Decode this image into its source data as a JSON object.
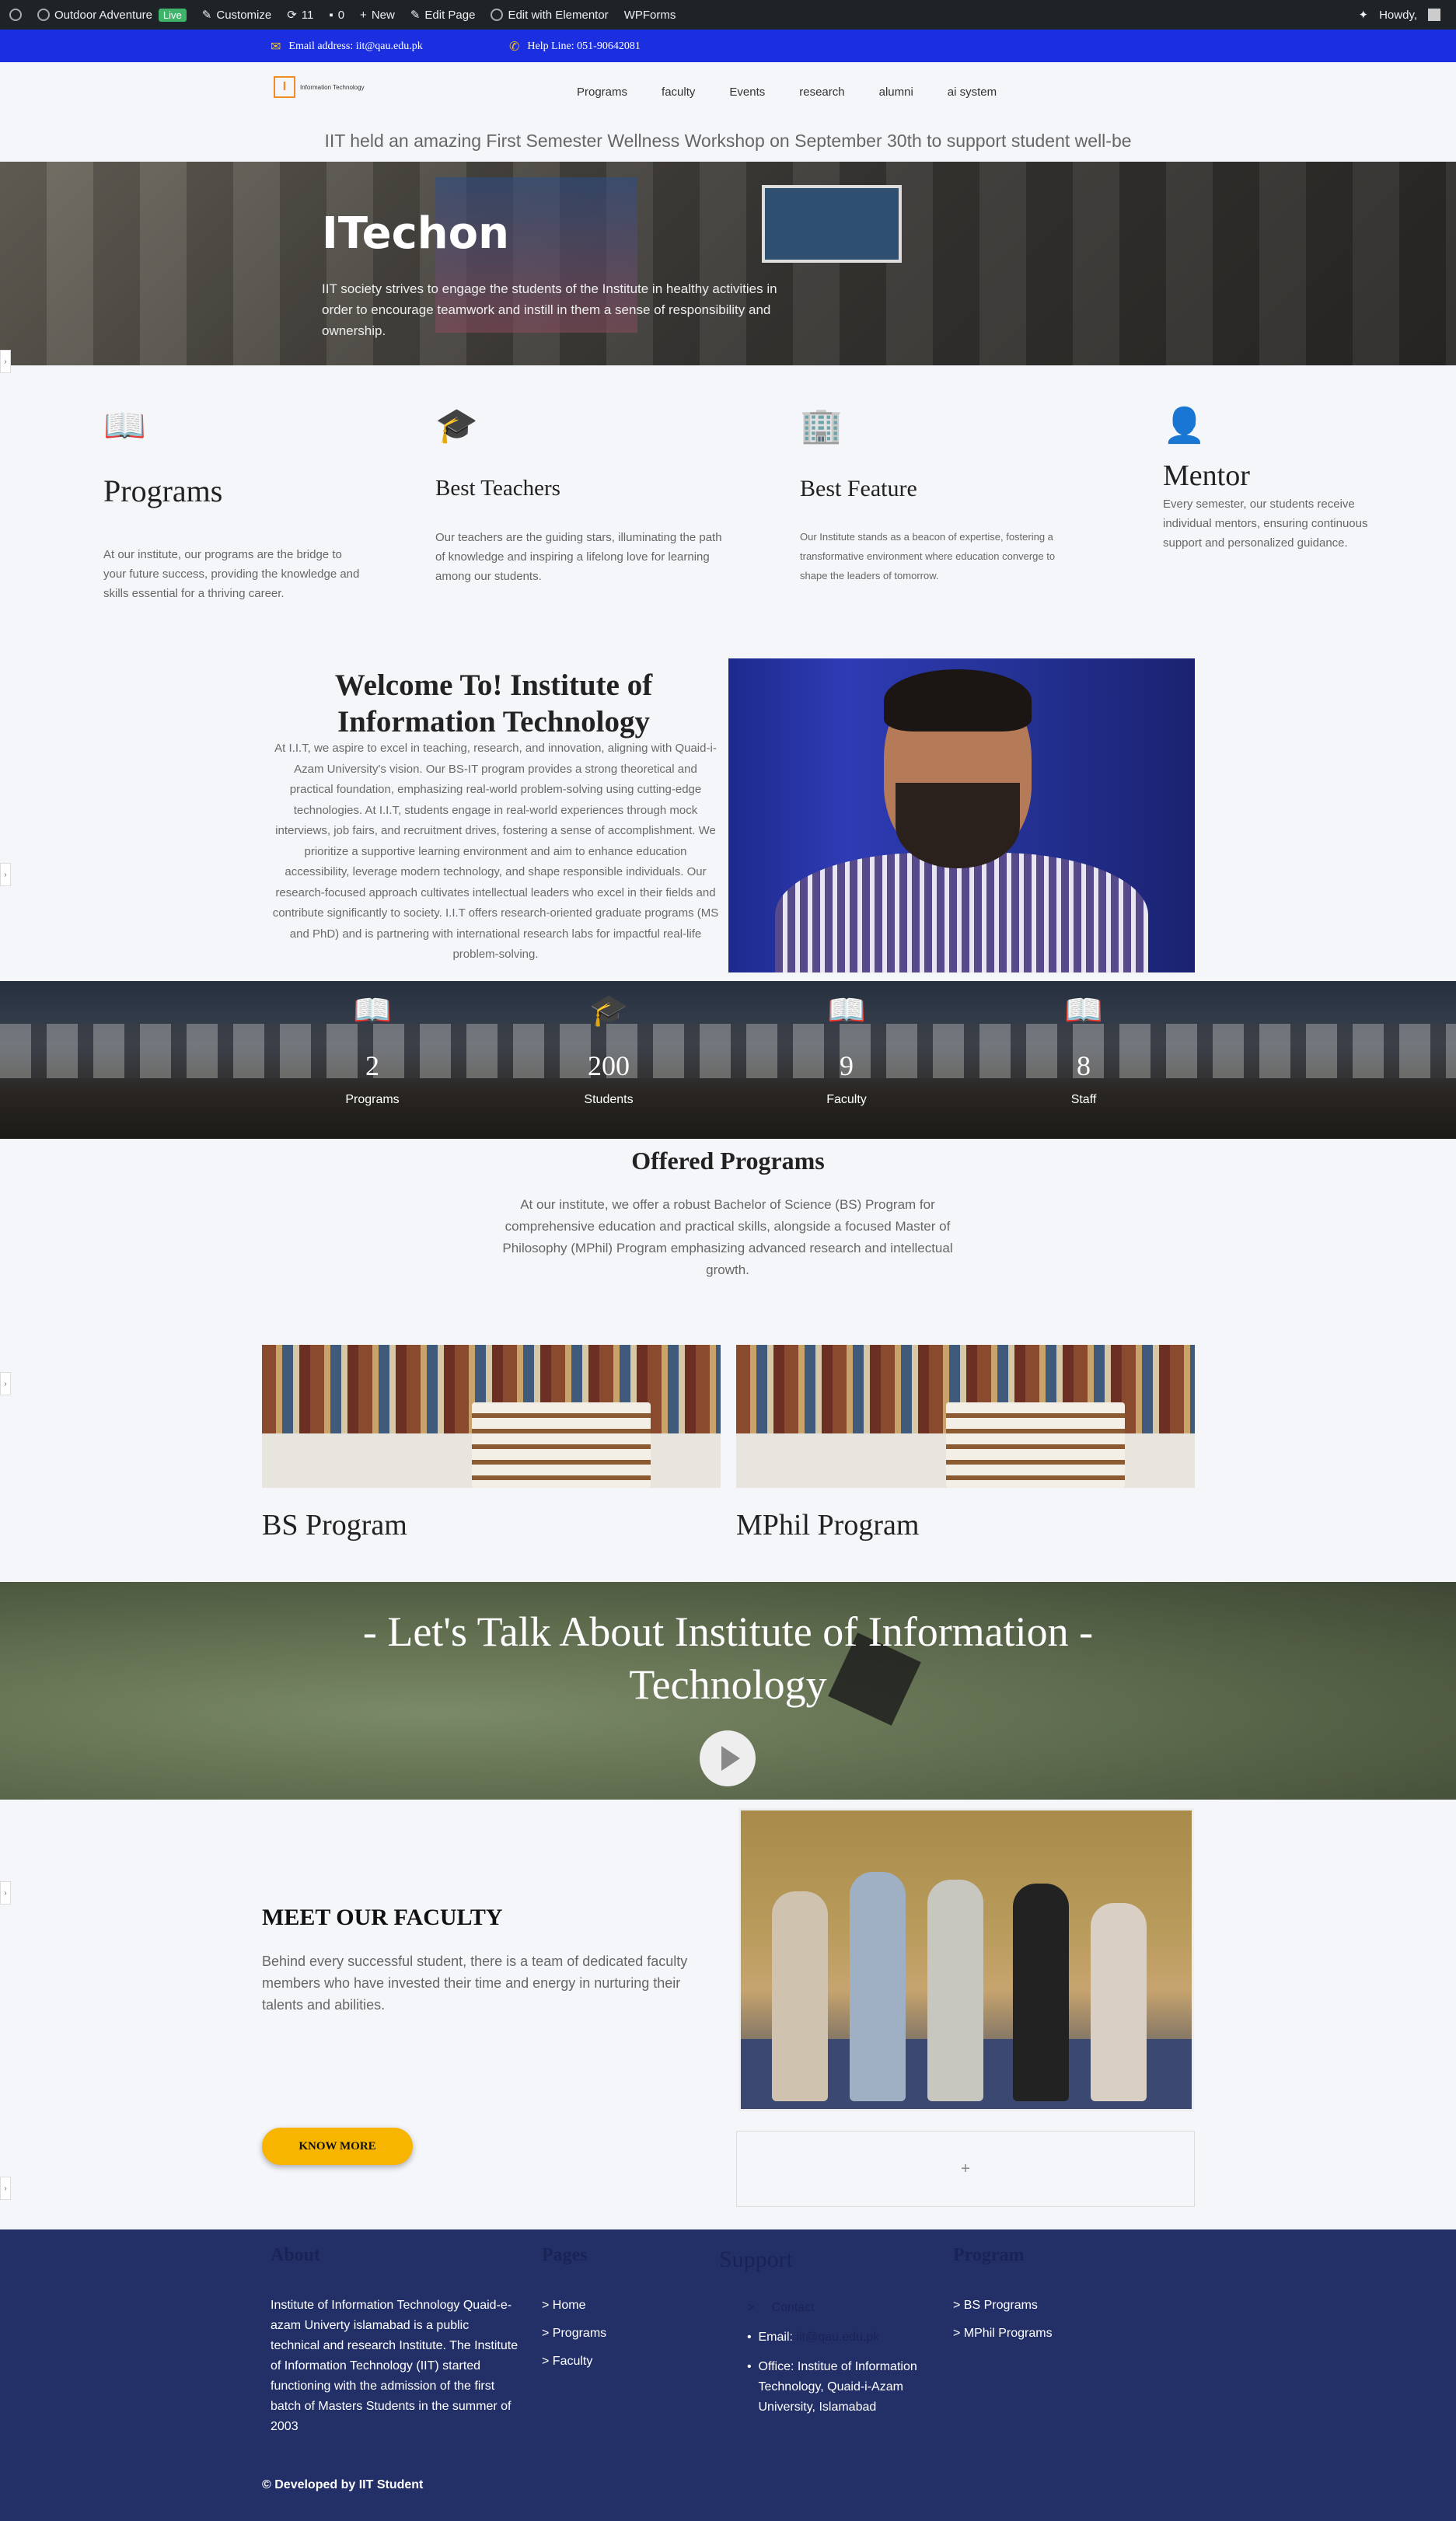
{
  "admin_bar": {
    "site_name": "Outdoor Adventure",
    "live_badge": "Live",
    "customize": "Customize",
    "updates_count": "11",
    "comments_count": "0",
    "new": "New",
    "edit_page": "Edit Page",
    "edit_elementor": "Edit with Elementor",
    "wpforms": "WPForms",
    "howdy": "Howdy, "
  },
  "topbar": {
    "email": "Email address: iit@qau.edu.pk",
    "helpline": "Help Line: 051-90642081",
    "icon_color": "#f4c20d",
    "bg_color": "#1c2fe0"
  },
  "header": {
    "logo_mark": "I",
    "logo_text": "Information Technology",
    "nav": [
      "Programs",
      "faculty",
      "Events",
      "research",
      "alumni",
      "ai system"
    ],
    "ticker": "IIT held an amazing First Semester Wellness Workshop on September 30th to support student well-be"
  },
  "hero": {
    "title": "ITechon",
    "text": "IIT society strives to engage the students of the Institute in healthy activities in order to encourage teamwork and instill in them a sense of responsibility and ownership."
  },
  "features": [
    {
      "title": "Programs",
      "icon": "book-icon",
      "color": "#5aaedc",
      "text": "At our institute, our programs are the bridge to your future success, providing the knowledge and skills essential for a thriving career."
    },
    {
      "title": "Best Teachers",
      "icon": "graduate-icon",
      "color": "#e030b0",
      "text": "Our teachers are the guiding stars, illuminating the path of knowledge and inspiring a lifelong love for learning among our students."
    },
    {
      "title": "Best Feature",
      "icon": "building-icon",
      "color": "#e0b400",
      "text": "Our Institute stands as a beacon of expertise, fostering a transformative environment where education converge to shape the leaders of tomorrow."
    },
    {
      "title": "Mentor",
      "icon": "user-clock-icon",
      "color": "#2bc42b",
      "text": "Every semester, our students receive individual mentors, ensuring continuous support and personalized guidance."
    }
  ],
  "welcome": {
    "title": "Welcome To! Institute of Information Technology",
    "body": "At I.I.T, we aspire to excel in teaching, research, and innovation, aligning with Quaid-i-Azam University's vision. Our BS-IT program provides a strong theoretical and practical foundation, emphasizing real-world problem-solving using cutting-edge technologies. At I.I.T, students engage in real-world experiences through mock interviews, job fairs, and recruitment drives, fostering a sense of accomplishment. We prioritize a supportive learning environment and aim to enhance education accessibility, leverage modern technology, and shape responsible individuals. Our research-focused approach cultivates intellectual leaders who excel in their fields and contribute significantly to society. I.I.T offers research-oriented graduate programs (MS and PhD) and is partnering with international research labs for impactful real-life problem-solving."
  },
  "stats": [
    {
      "number": "2",
      "label": "Programs",
      "icon": "book-icon"
    },
    {
      "number": "200",
      "label": "Students",
      "icon": "graduate-icon"
    },
    {
      "number": "9",
      "label": "Faculty",
      "icon": "book-icon"
    },
    {
      "number": "8",
      "label": "Staff",
      "icon": "book-icon"
    }
  ],
  "offered": {
    "title": "Offered Programs",
    "body": "At our institute, we offer a robust Bachelor of Science (BS) Program for comprehensive education and practical skills, alongside a focused Master of Philosophy (MPhil) Program emphasizing advanced research and intellectual growth.",
    "programs": [
      "BS Program",
      "MPhil Program"
    ]
  },
  "video": {
    "title": "- Let's Talk About Institute of Information - Technology"
  },
  "faculty": {
    "title": "MEET OUR FACULTY",
    "body": "Behind every successful student, there is a team of dedicated faculty members who have invested their time and energy in nurturing their talents and abilities.",
    "button": "KNOW MORE",
    "add_symbol": "+"
  },
  "footer": {
    "about_title": "About",
    "about_text": "Institute of Information Technology Quaid-e-azam Univerty islamabad is a public technical and research Institute. The Institute of Information Technology (IIT) started functioning with the admission of the first batch of Masters Students in the summer of 2003",
    "pages_title": "Pages",
    "pages": [
      "> Home",
      "> Programs",
      "> Faculty"
    ],
    "support_title": "Support",
    "support_contact": "Contact",
    "support_email_label": "Email:",
    "support_email": "iit@qau.edu.pk",
    "support_office": "Office: Institue of Information Technology, Quaid-i-Azam University, Islamabad",
    "program_title": "Program",
    "programs": [
      "> BS Programs",
      "> MPhil Programs"
    ],
    "copyright": "© Developed by IIT Student"
  }
}
